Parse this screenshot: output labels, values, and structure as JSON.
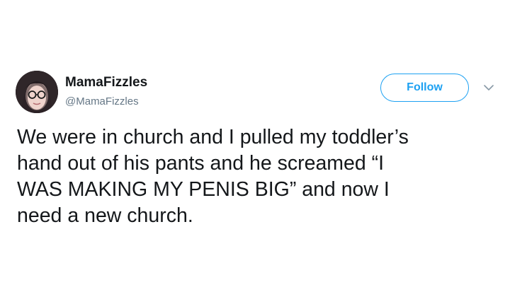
{
  "author": {
    "display_name": "MamaFizzles",
    "handle": "@MamaFizzles",
    "avatar_icon": "profile-photo"
  },
  "follow_button": {
    "label": "Follow",
    "color": "#1da1f2"
  },
  "more_menu": {
    "icon": "chevron-down-icon"
  },
  "tweet": {
    "text": "We were in church and I pulled my toddler’s\nhand out of his pants and he screamed “I\nWAS MAKING MY PENIS BIG” and now I\nneed a new church."
  }
}
